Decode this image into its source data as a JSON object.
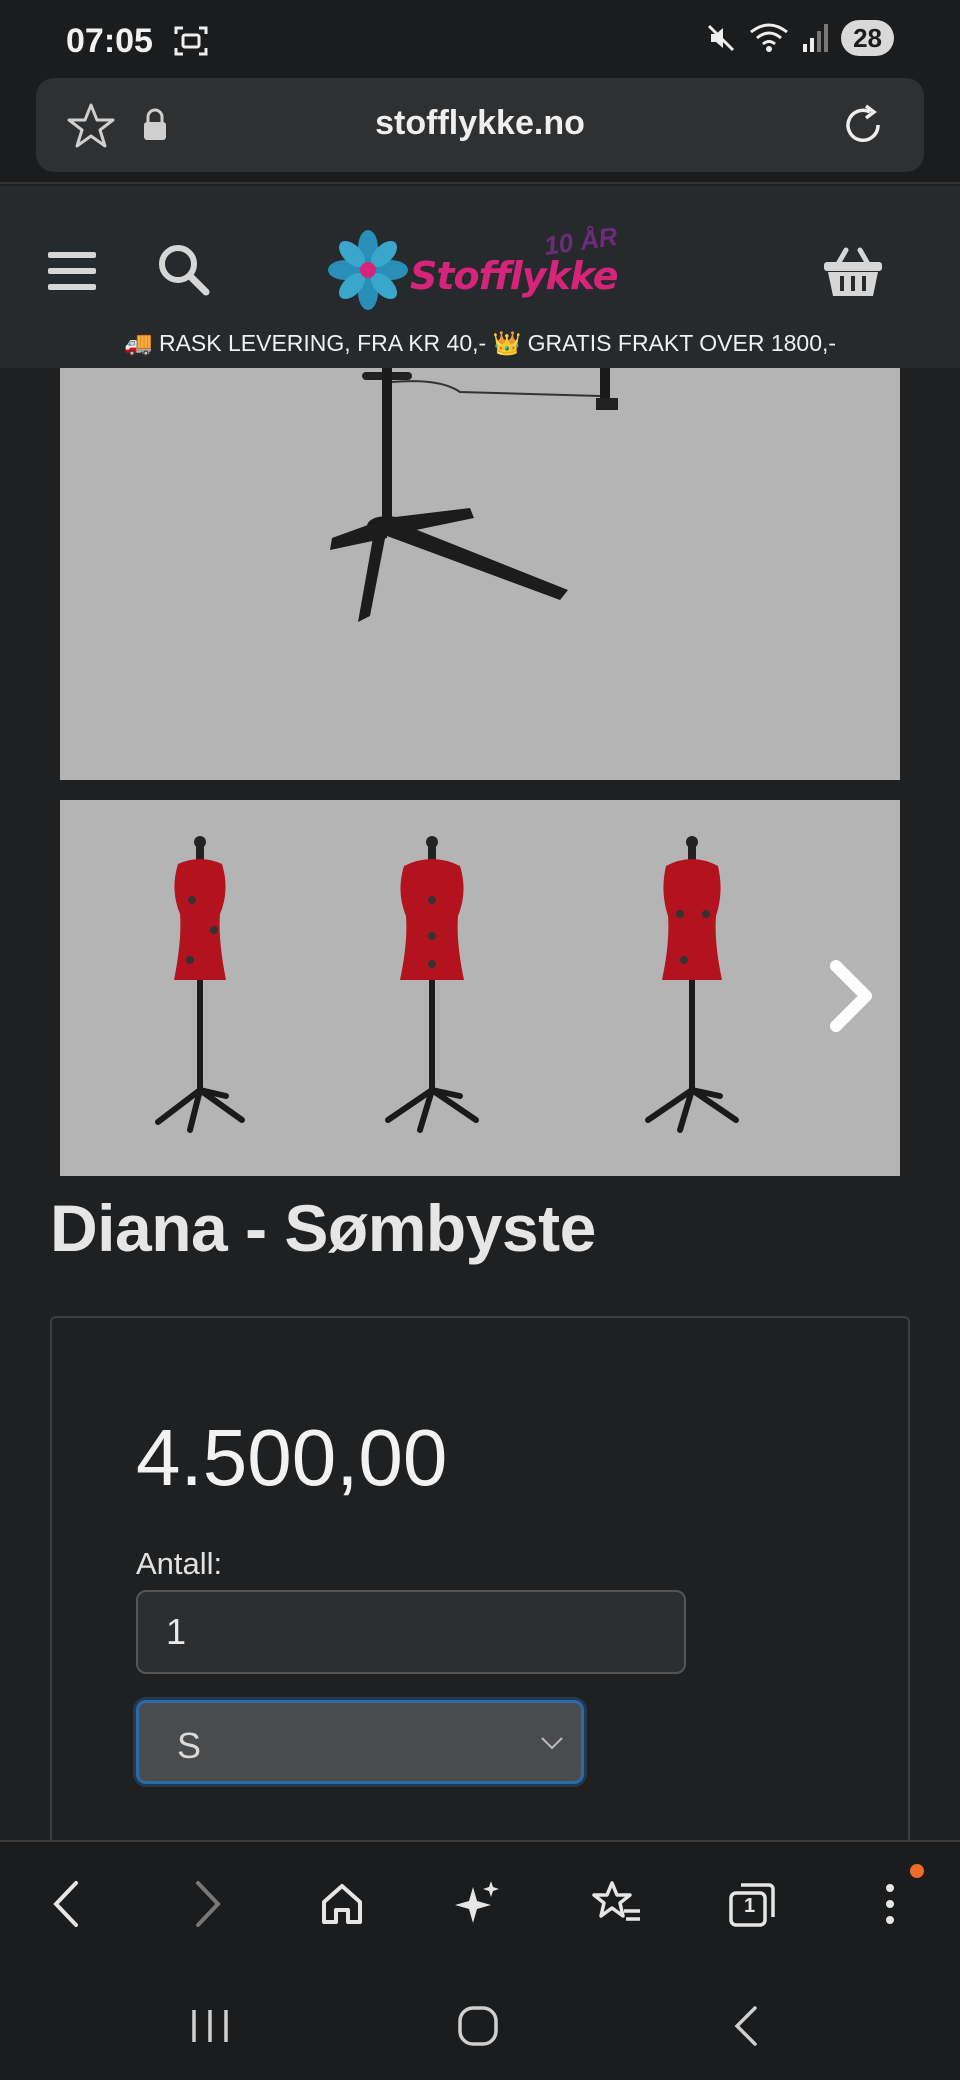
{
  "status": {
    "time": "07:05",
    "battery": "28",
    "icons": [
      "screenshot-icon",
      "mute-icon",
      "wifi-icon",
      "signal-icon"
    ]
  },
  "browser": {
    "url": "stofflykke.no",
    "icons": [
      "favorite-star-icon",
      "lock-icon",
      "reload-icon"
    ]
  },
  "site": {
    "logo_text": "Stofflykke",
    "logo_badge": "10 ÅR",
    "promo": "🚚 RASK LEVERING, FRA KR 40,- 👑 GRATIS FRAKT OVER 1800,-",
    "icons": [
      "hamburger-menu-icon",
      "search-icon",
      "shopping-basket-icon"
    ]
  },
  "product": {
    "title": "Diana - Sømbyste",
    "price": "4.500,00",
    "quantity_label": "Antall:",
    "quantity_value": "1",
    "size_selected": "S"
  },
  "toolbar": {
    "items": [
      "back-icon",
      "forward-icon",
      "home-icon",
      "ai-sparkle-icon",
      "bookmarks-icon",
      "tabs-icon",
      "more-icon"
    ],
    "tab_count": "1"
  },
  "colors": {
    "background": "#1f2021",
    "header": "#262a2c",
    "image_bg": "#b4b4b4",
    "dress_form_red": "#b3121f",
    "select_focus": "#2c6aa8",
    "notification": "#f06a2a"
  }
}
